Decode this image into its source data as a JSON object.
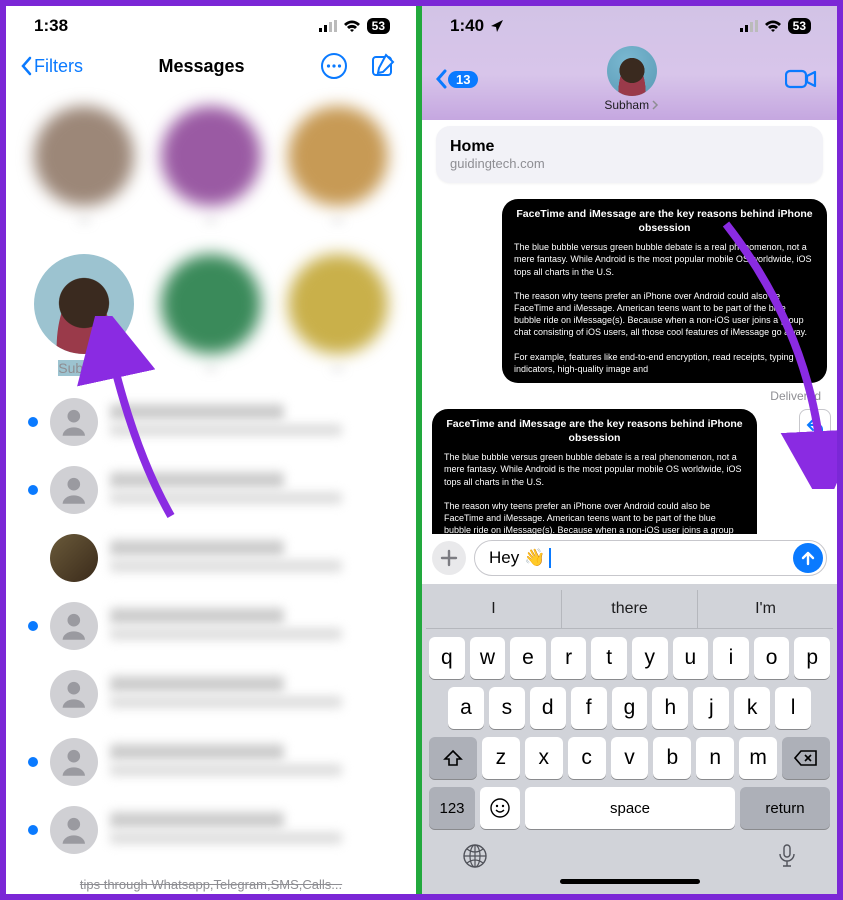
{
  "left": {
    "time": "1:38",
    "battery": "53",
    "filters_label": "Filters",
    "title": "Messages",
    "pinned": {
      "subham_label": "Subham"
    },
    "footer_caption": "tips through Whatsapp,Telegram,SMS,Calls..."
  },
  "right": {
    "time": "1:40",
    "battery": "53",
    "back_count": "13",
    "contact_name": "Subham",
    "link_preview": {
      "title": "Home",
      "domain": "guidingtech.com"
    },
    "bubble": {
      "title": "FaceTime and iMessage are the key reasons behind iPhone obsession",
      "p1": "The blue bubble versus green bubble debate is a real phenomenon, not a mere fantasy. While Android is the most popular mobile OS worldwide, iOS tops all charts in the U.S.",
      "p2": "The reason why teens prefer an iPhone over Android could also be FaceTime and iMessage. American teens want to be part of the blue bubble ride on iMessage(s). Because when a non-iOS user joins a group chat consisting of iOS users, all those cool features of iMessage go away.",
      "p3": "For example, features like end-to-end encryption, read receipts, typing indicators, high-quality image and"
    },
    "delivered_label": "Delivered",
    "input_text": "Hey 👋",
    "suggestions": [
      "I",
      "there",
      "I'm"
    ],
    "keys": {
      "row1": [
        "q",
        "w",
        "e",
        "r",
        "t",
        "y",
        "u",
        "i",
        "o",
        "p"
      ],
      "row2": [
        "a",
        "s",
        "d",
        "f",
        "g",
        "h",
        "j",
        "k",
        "l"
      ],
      "row3": [
        "z",
        "x",
        "c",
        "v",
        "b",
        "n",
        "m"
      ],
      "num_key": "123",
      "space_key": "space",
      "return_key": "return"
    }
  }
}
